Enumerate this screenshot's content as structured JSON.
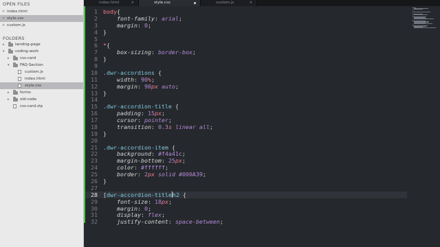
{
  "sidebar": {
    "open_files_title": "OPEN FILES",
    "open_files": [
      {
        "name": "index.html",
        "selected": false
      },
      {
        "name": "style.css",
        "selected": true
      },
      {
        "name": "custom.js",
        "selected": false
      }
    ],
    "folders_title": "FOLDERS",
    "tree": [
      {
        "name": "landing-page",
        "type": "folder",
        "expanded": false,
        "depth": 0
      },
      {
        "name": "coding-work",
        "type": "folder",
        "expanded": true,
        "depth": 0
      },
      {
        "name": "css-card",
        "type": "folder",
        "expanded": false,
        "depth": 1
      },
      {
        "name": "FAQ-Section",
        "type": "folder",
        "expanded": true,
        "depth": 1
      },
      {
        "name": "custom.js",
        "type": "file",
        "icon": "/*",
        "depth": 2
      },
      {
        "name": "index.html",
        "type": "file",
        "icon": "<>",
        "depth": 2
      },
      {
        "name": "style.css",
        "type": "file",
        "icon": "/*",
        "depth": 2,
        "selected": true
      },
      {
        "name": "forms",
        "type": "folder",
        "expanded": false,
        "depth": 1
      },
      {
        "name": "old-code",
        "type": "folder",
        "expanded": false,
        "depth": 1
      },
      {
        "name": "css-card.zip",
        "type": "zip",
        "depth": 1
      }
    ]
  },
  "tabs": [
    {
      "label": "index.html",
      "active": false
    },
    {
      "label": "style.css",
      "active": true
    },
    {
      "label": "custom.js",
      "active": false
    }
  ],
  "editor": {
    "current_line": 28,
    "lines": [
      {
        "n": "1",
        "tokens": [
          [
            "sel",
            "body"
          ],
          [
            "brace",
            "{"
          ]
        ]
      },
      {
        "n": "2",
        "tokens": [
          [
            "indent",
            "    "
          ],
          [
            "prop",
            "font-family"
          ],
          [
            "punct",
            ": "
          ],
          [
            "val",
            "arial"
          ],
          [
            "punct",
            ";"
          ]
        ]
      },
      {
        "n": "3",
        "tokens": [
          [
            "indent",
            "    "
          ],
          [
            "prop",
            "margin"
          ],
          [
            "punct",
            ": "
          ],
          [
            "num",
            "0"
          ],
          [
            "punct",
            ";"
          ]
        ]
      },
      {
        "n": "4",
        "tokens": [
          [
            "brace",
            "}"
          ]
        ]
      },
      {
        "n": "5",
        "tokens": []
      },
      {
        "n": "6",
        "tokens": [
          [
            "sel",
            "*"
          ],
          [
            "brace",
            "{"
          ]
        ]
      },
      {
        "n": "7",
        "tokens": [
          [
            "indent",
            "    "
          ],
          [
            "prop",
            "box-sizing"
          ],
          [
            "punct",
            ": "
          ],
          [
            "val",
            "border-box"
          ],
          [
            "punct",
            ";"
          ]
        ]
      },
      {
        "n": "8",
        "tokens": [
          [
            "brace",
            "}"
          ]
        ]
      },
      {
        "n": "9",
        "tokens": []
      },
      {
        "n": "10",
        "tokens": [
          [
            "cls",
            ".dwr-accordions"
          ],
          [
            "punct",
            " "
          ],
          [
            "brace",
            "{"
          ]
        ]
      },
      {
        "n": "11",
        "tokens": [
          [
            "indent",
            "    "
          ],
          [
            "prop",
            "width"
          ],
          [
            "punct",
            ": "
          ],
          [
            "num",
            "90"
          ],
          [
            "unit",
            "%"
          ],
          [
            "punct",
            ";"
          ]
        ]
      },
      {
        "n": "12",
        "tokens": [
          [
            "indent",
            "    "
          ],
          [
            "prop",
            "margin"
          ],
          [
            "punct",
            ": "
          ],
          [
            "num",
            "90"
          ],
          [
            "unit",
            "px"
          ],
          [
            "punct",
            " "
          ],
          [
            "val",
            "auto"
          ],
          [
            "punct",
            ";"
          ]
        ]
      },
      {
        "n": "13",
        "tokens": [
          [
            "brace",
            "}"
          ]
        ]
      },
      {
        "n": "14",
        "tokens": []
      },
      {
        "n": "15",
        "tokens": [
          [
            "cls",
            ".dwr-accordion-title"
          ],
          [
            "punct",
            " "
          ],
          [
            "brace",
            "{"
          ]
        ]
      },
      {
        "n": "16",
        "tokens": [
          [
            "indent",
            "    "
          ],
          [
            "prop",
            "padding"
          ],
          [
            "punct",
            ": "
          ],
          [
            "num",
            "15"
          ],
          [
            "unit",
            "px"
          ],
          [
            "punct",
            ";"
          ]
        ]
      },
      {
        "n": "17",
        "tokens": [
          [
            "indent",
            "    "
          ],
          [
            "prop",
            "cursor"
          ],
          [
            "punct",
            ": "
          ],
          [
            "val",
            "pointer"
          ],
          [
            "punct",
            ";"
          ]
        ]
      },
      {
        "n": "18",
        "tokens": [
          [
            "indent",
            "    "
          ],
          [
            "prop",
            "transition"
          ],
          [
            "punct",
            ": "
          ],
          [
            "num",
            "0.3"
          ],
          [
            "unit",
            "s"
          ],
          [
            "punct",
            " "
          ],
          [
            "val",
            "linear all"
          ],
          [
            "punct",
            ";"
          ]
        ]
      },
      {
        "n": "19",
        "tokens": [
          [
            "brace",
            "}"
          ]
        ]
      },
      {
        "n": "20",
        "tokens": []
      },
      {
        "n": "21",
        "tokens": [
          [
            "cls",
            ".dwr-accordion-item"
          ],
          [
            "punct",
            " "
          ],
          [
            "brace",
            "{"
          ]
        ]
      },
      {
        "n": "22",
        "tokens": [
          [
            "indent",
            "    "
          ],
          [
            "prop",
            "background"
          ],
          [
            "punct",
            ": "
          ],
          [
            "num",
            "#f4a41c"
          ],
          [
            "punct",
            ";"
          ]
        ]
      },
      {
        "n": "23",
        "tokens": [
          [
            "indent",
            "    "
          ],
          [
            "prop",
            "margin-bottom"
          ],
          [
            "punct",
            ": "
          ],
          [
            "num",
            "25"
          ],
          [
            "unit",
            "px"
          ],
          [
            "punct",
            ";"
          ]
        ]
      },
      {
        "n": "24",
        "tokens": [
          [
            "indent",
            "    "
          ],
          [
            "prop",
            "color"
          ],
          [
            "punct",
            ": "
          ],
          [
            "num",
            "#ffffff"
          ],
          [
            "punct",
            ";"
          ]
        ]
      },
      {
        "n": "25",
        "tokens": [
          [
            "indent",
            "    "
          ],
          [
            "prop",
            "border"
          ],
          [
            "punct",
            ": "
          ],
          [
            "num",
            "2"
          ],
          [
            "unit",
            "px"
          ],
          [
            "punct",
            " "
          ],
          [
            "val",
            "solid"
          ],
          [
            "punct",
            " "
          ],
          [
            "num",
            "#000A39"
          ],
          [
            "punct",
            ";"
          ]
        ]
      },
      {
        "n": "26",
        "tokens": [
          [
            "brace",
            "}"
          ]
        ]
      },
      {
        "n": "27",
        "tokens": []
      },
      {
        "n": "28",
        "tokens": [
          [
            "punct",
            "["
          ],
          [
            "cls",
            "dwr-accordion-title"
          ],
          [
            "cursor",
            ""
          ],
          [
            "cls",
            "h2"
          ],
          [
            "punct",
            " "
          ],
          [
            "brace",
            "{"
          ]
        ]
      },
      {
        "n": "29",
        "tokens": [
          [
            "indent",
            "    "
          ],
          [
            "prop",
            "font-size"
          ],
          [
            "punct",
            ": "
          ],
          [
            "num",
            "18"
          ],
          [
            "unit",
            "px"
          ],
          [
            "punct",
            ";"
          ]
        ]
      },
      {
        "n": "30",
        "tokens": [
          [
            "indent",
            "    "
          ],
          [
            "prop",
            "margin"
          ],
          [
            "punct",
            ": "
          ],
          [
            "num",
            "0"
          ],
          [
            "punct",
            ";"
          ]
        ]
      },
      {
        "n": "31",
        "tokens": [
          [
            "indent",
            "    "
          ],
          [
            "prop",
            "display"
          ],
          [
            "punct",
            ": "
          ],
          [
            "val",
            "flex"
          ],
          [
            "punct",
            ";"
          ]
        ]
      },
      {
        "n": "32",
        "tokens": [
          [
            "indent",
            "    "
          ],
          [
            "prop",
            "justify-content"
          ],
          [
            "punct",
            ": "
          ],
          [
            "val",
            "space-between"
          ],
          [
            "punct",
            ";"
          ]
        ]
      }
    ]
  }
}
